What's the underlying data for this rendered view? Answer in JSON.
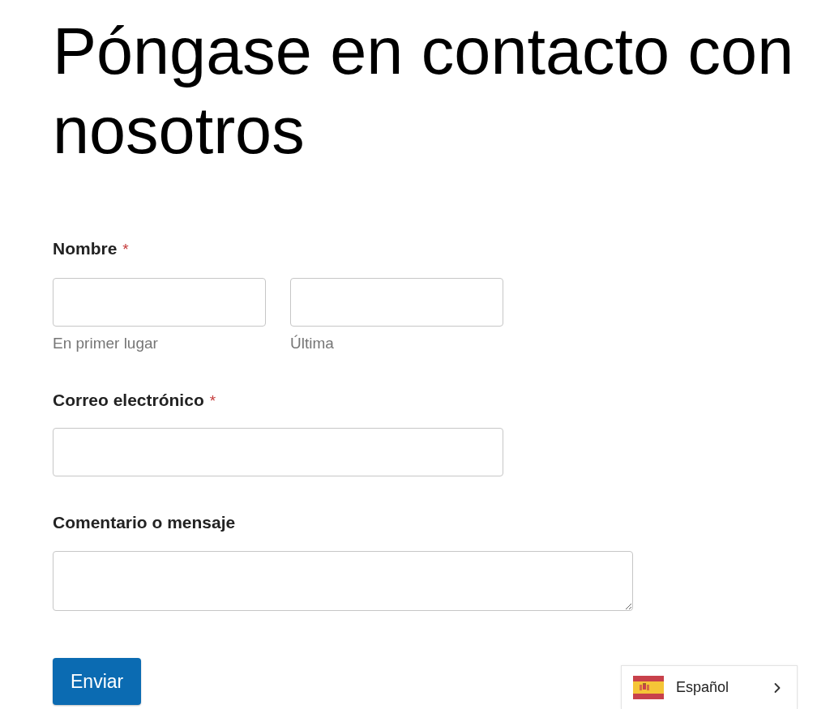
{
  "title": "Póngase en contacto con nosotros",
  "fields": [
    {
      "kind": "name",
      "label": "Nombre",
      "required_mark": "*",
      "parts": [
        {
          "sublabel": "En primer lugar"
        },
        {
          "sublabel": "Última"
        }
      ]
    },
    {
      "kind": "email",
      "label": "Correo electrónico",
      "required_mark": "*"
    },
    {
      "kind": "textarea",
      "label": "Comentario o mensaje"
    }
  ],
  "submit_button": "Enviar",
  "language_switcher": {
    "language": "Español"
  }
}
